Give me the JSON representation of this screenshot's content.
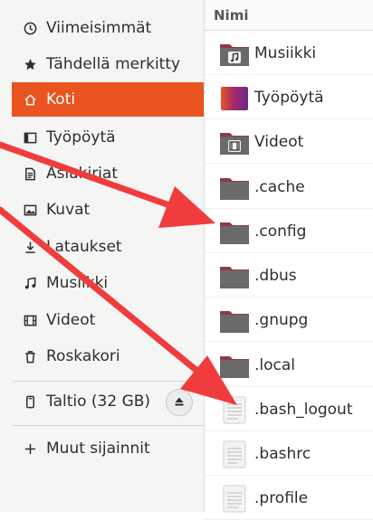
{
  "sidebar": {
    "items": [
      {
        "label": "Viimeisimmät",
        "icon": "clock-icon",
        "active": false
      },
      {
        "label": "Tähdellä merkitty",
        "icon": "star-icon",
        "active": false
      },
      {
        "label": "Koti",
        "icon": "home-icon",
        "active": true
      },
      {
        "label": "Työpöytä",
        "icon": "desktop-icon",
        "active": false
      },
      {
        "label": "Asiakirjat",
        "icon": "document-icon",
        "active": false
      },
      {
        "label": "Kuvat",
        "icon": "picture-icon",
        "active": false
      },
      {
        "label": "Lataukset",
        "icon": "download-icon",
        "active": false
      },
      {
        "label": "Musiikki",
        "icon": "music-icon",
        "active": false
      },
      {
        "label": "Videot",
        "icon": "film-icon",
        "active": false
      },
      {
        "label": "Roskakori",
        "icon": "trash-icon",
        "active": false
      }
    ],
    "device": {
      "label": "Taltio (32 GB)",
      "icon": "drive-icon",
      "eject_icon": "eject-icon"
    },
    "other_locations": {
      "label": "Muut sijainnit",
      "icon": "plus-icon"
    }
  },
  "file_list": {
    "column_header": "Nimi",
    "rows": [
      {
        "name": "Musiikki",
        "icon": "folder-music-icon"
      },
      {
        "name": "Työpöytä",
        "icon": "folder-desktop-icon"
      },
      {
        "name": "Videot",
        "icon": "folder-video-icon"
      },
      {
        "name": ".cache",
        "icon": "folder-icon"
      },
      {
        "name": ".config",
        "icon": "folder-icon"
      },
      {
        "name": ".dbus",
        "icon": "folder-icon"
      },
      {
        "name": ".gnupg",
        "icon": "folder-icon"
      },
      {
        "name": ".local",
        "icon": "folder-icon"
      },
      {
        "name": ".bash_logout",
        "icon": "text-file-icon"
      },
      {
        "name": ".bashrc",
        "icon": "text-file-icon"
      },
      {
        "name": ".profile",
        "icon": "text-file-icon"
      }
    ]
  },
  "colors": {
    "accent": "#e95420",
    "folder_body": "#6a6a6a",
    "folder_tab": "#8e3a46",
    "annotation_arrow": "#f03c3c"
  }
}
